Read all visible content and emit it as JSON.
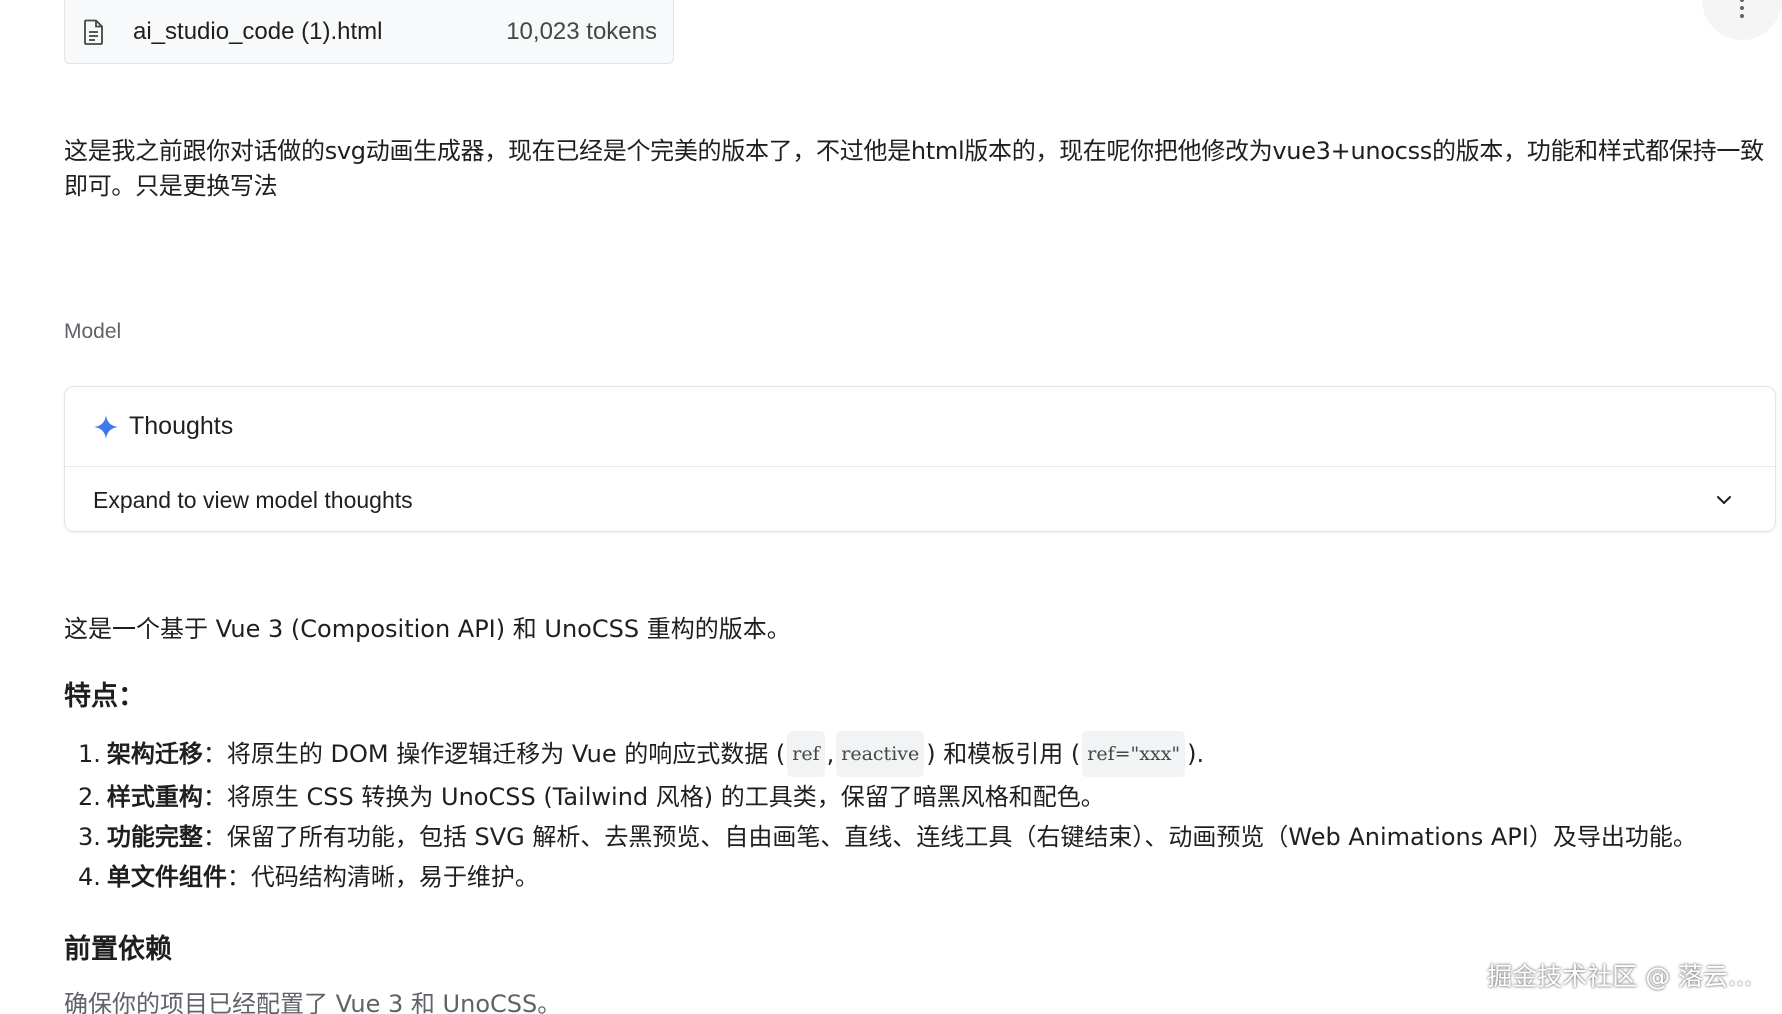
{
  "file": {
    "name": "ai_studio_code (1).html",
    "tokens": "10,023 tokens",
    "icon": "document-icon"
  },
  "more_menu": {
    "icon": "more-vert-icon"
  },
  "user_message": "这是我之前跟你对话做的svg动画生成器，现在已经是个完美的版本了，不过他是html版本的，现在呢你把他修改为vue3+unocss的版本，功能和样式都保持一致即可。只是更换写法",
  "model_label": "Model",
  "thoughts": {
    "icon": "sparkle-icon",
    "title": "Thoughts",
    "expand_text": "Expand to view model thoughts",
    "chevron_icon": "chevron-down-icon"
  },
  "answer": {
    "intro": "这是一个基于 Vue 3 (Composition API) 和 UnoCSS 重构的版本。",
    "features_heading": "特点：",
    "features": [
      {
        "num": "1.",
        "title": "架构迁移",
        "pre": "：将原生的 DOM 操作逻辑迁移为 Vue 的响应式数据 (",
        "code1": "ref",
        "mid1": ", ",
        "code2": "reactive",
        "mid2": ") 和模板引用 (",
        "code3": "ref=\"xxx\"",
        "post": ")."
      },
      {
        "num": "2.",
        "title": "样式重构",
        "text": "：将原生 CSS 转换为 UnoCSS (Tailwind 风格) 的工具类，保留了暗黑风格和配色。"
      },
      {
        "num": "3.",
        "title": "功能完整",
        "text": "：保留了所有功能，包括 SVG 解析、去黑预览、自由画笔、直线、连线工具（右键结束）、动画预览（Web Animations API）及导出功能。"
      },
      {
        "num": "4.",
        "title": "单文件组件",
        "text": "：代码结构清晰，易于维护。"
      }
    ],
    "deps_heading": "前置依赖",
    "deps_text": "确保你的项目已经配置了 Vue 3 和 UnoCSS。"
  },
  "watermark": "掘金技术社区 @ 落云..."
}
